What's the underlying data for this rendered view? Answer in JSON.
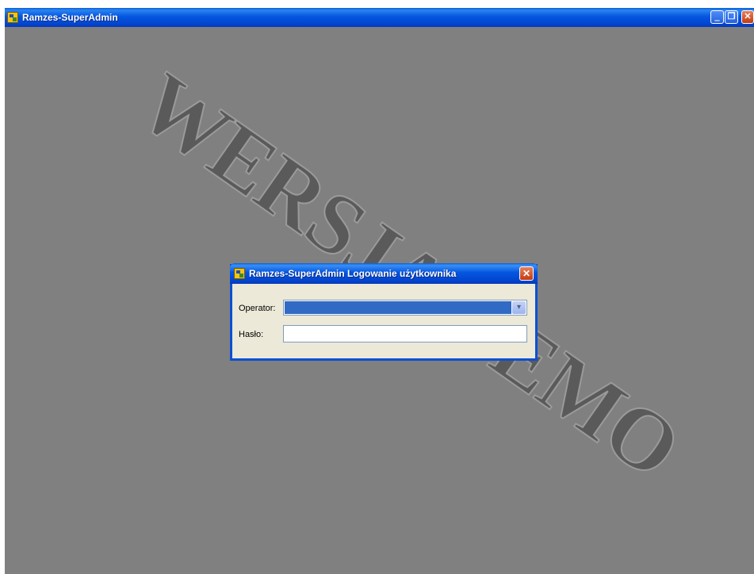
{
  "main_window": {
    "title": "Ramzes-SuperAdmin",
    "minimize_glyph": "‗",
    "maximize_glyph": "❐",
    "close_glyph": "✕",
    "icon": "ramzes-app-icon"
  },
  "watermark": {
    "text": "WERSJA DEMO"
  },
  "login_dialog": {
    "title": "Ramzes-SuperAdmin Logowanie użytkownika",
    "close_glyph": "✕",
    "operator_label": "Operator:",
    "operator_value": "",
    "dropdown_glyph": "▾",
    "password_label": "Hasło:",
    "password_value": ""
  },
  "colors": {
    "titlebar_blue": "#0456e0",
    "desktop_gray": "#808080",
    "dialog_face": "#ece9d8",
    "selection_blue": "#316ac5",
    "close_red": "#c43b12"
  }
}
